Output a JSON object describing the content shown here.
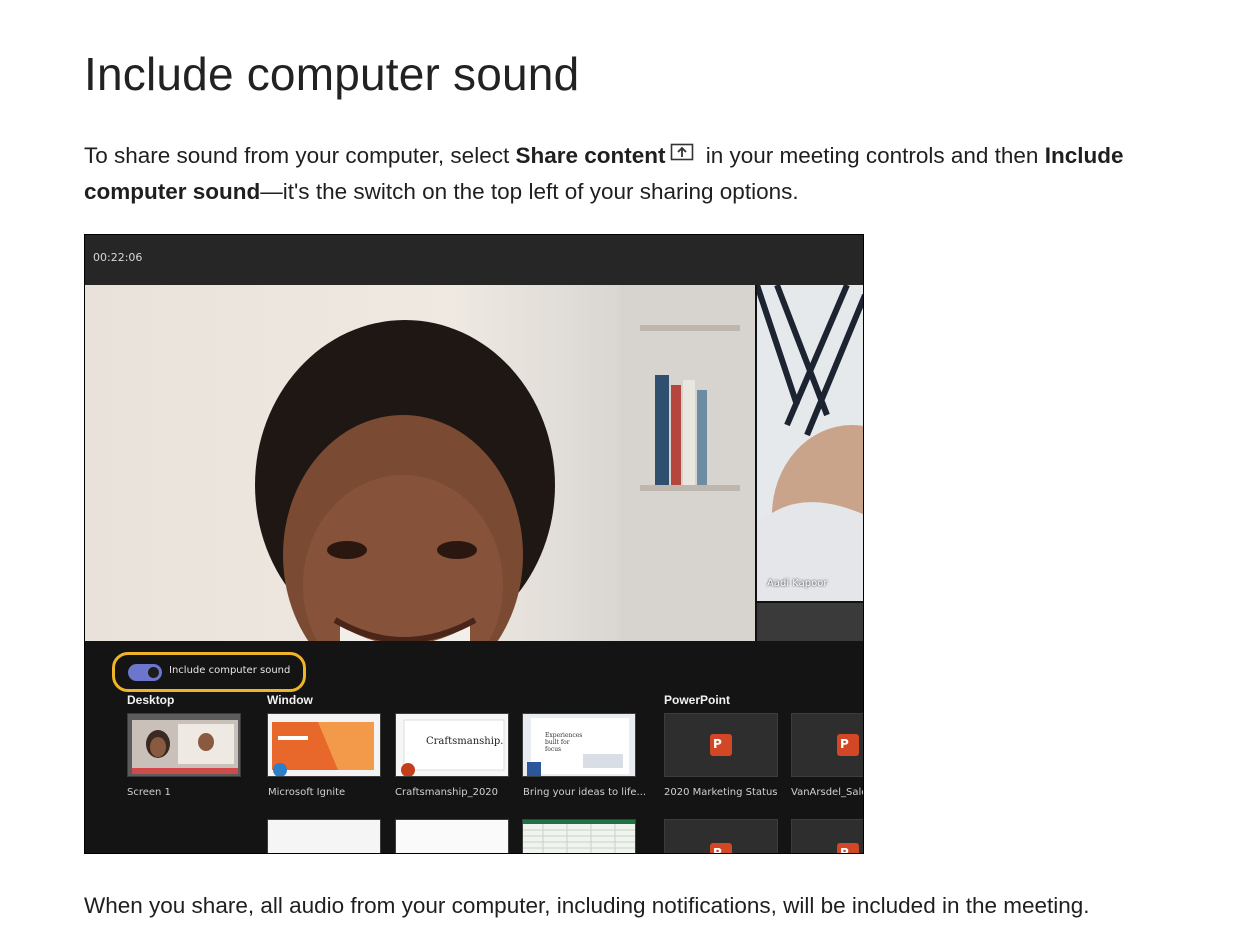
{
  "article": {
    "title": "Include computer sound",
    "intro": {
      "part1": "To share sound from your computer, select ",
      "share_content": "Share content",
      "part2": " in your meeting controls and then ",
      "include_sound": "Include computer sound",
      "part3": "—it's the switch on the top left of your sharing options."
    },
    "outro": "When you share, all audio from your computer, including notifications, will be included in the meeting."
  },
  "screenshot": {
    "timer": "00:22:06",
    "side_participant": "Aadi Kapoor",
    "toggle": {
      "label": "Include computer sound",
      "on": true,
      "highlight_color": "#f0b429",
      "switch_color": "#6b76cc"
    },
    "sections": {
      "desktop": "Desktop",
      "window": "Window",
      "powerpoint": "PowerPoint"
    },
    "desktop_items": [
      "Screen 1"
    ],
    "window_items": [
      "Microsoft Ignite",
      "Craftsmanship_2020",
      "Bring your ideas to life..."
    ],
    "powerpoint_items": [
      "2020 Marketing Status",
      "VanArsdel_Sales"
    ],
    "tile_texts": {
      "craftsmanship": "Craftsmanship.",
      "experiences": "Experiences built for focus"
    }
  }
}
